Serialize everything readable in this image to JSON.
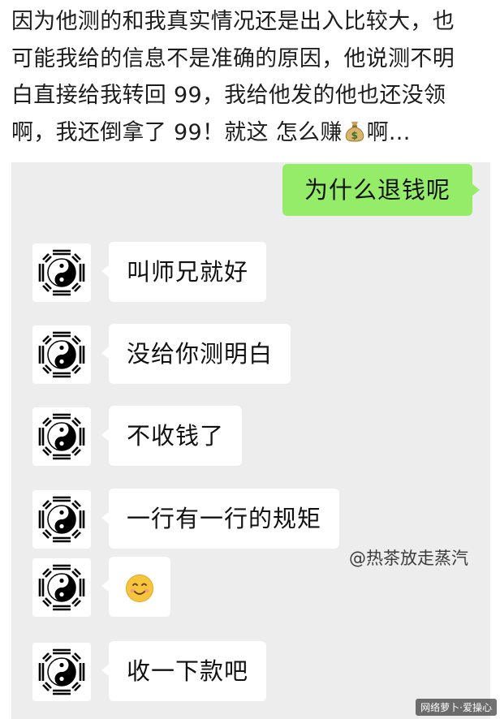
{
  "intro_text": {
    "line1": "因为他测的和我真实情况还是出入比较大，也",
    "line2": "可能我给的信息不是准确的原因，他说测不明",
    "line3": "白直接给我转回 99，我给他发的他也还没领",
    "line4_before_icon": "啊，我还倒拿了 99！就这 怎么赚",
    "line4_after_icon": "啊...",
    "inline_icon": "money-bag-icon"
  },
  "chat": {
    "background_color": "#ededed",
    "outgoing_bubble_color": "#95ec69",
    "outgoing_message": "为什么退钱呢",
    "incoming_avatar_icon": "bagua-yin-yang-icon",
    "incoming_messages": [
      "叫师兄就好",
      "没给你测明白",
      "不收钱了",
      "一行有一行的规矩",
      "",
      "收一下款吧"
    ],
    "emoji_icon": "smiling-face-emoji-icon"
  },
  "watermark": "@热茶放走蒸汽",
  "corner_mark": "网络萝卜·爱操心"
}
